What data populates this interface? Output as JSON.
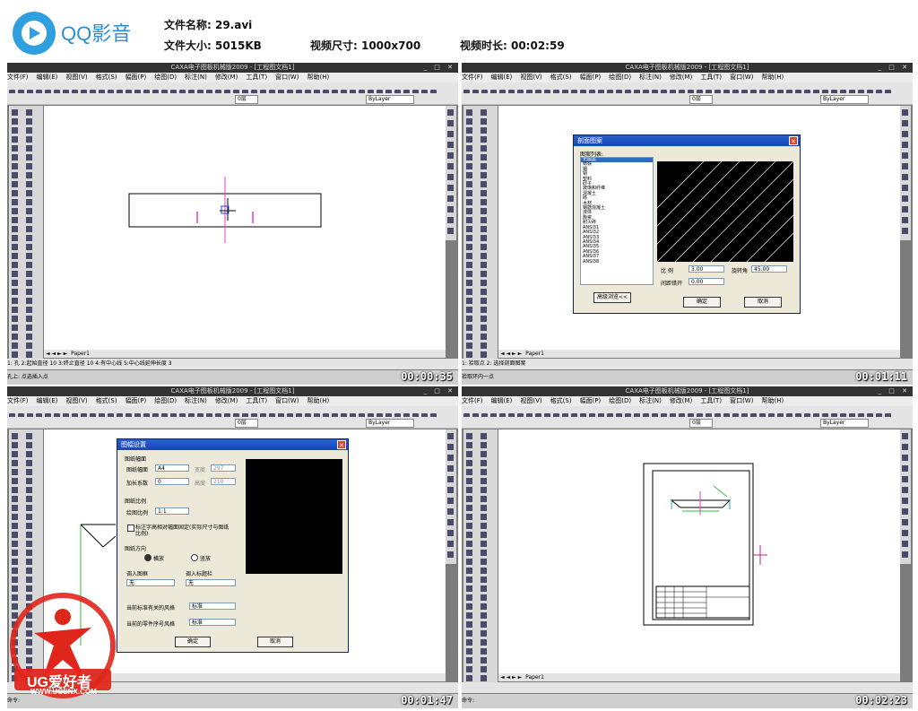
{
  "app": {
    "brand": "QQ影音"
  },
  "file_info": {
    "name_label": "文件名称: 29.avi",
    "size_label": "文件大小: 5015KB",
    "dimensions_label": "视频尺寸: 1000x700",
    "duration_label": "视频时长: 00:02:59"
  },
  "cad": {
    "window_title": "CAXA电子图板机械版2009 - [工程图文档1]",
    "menu": [
      "文件(F)",
      "编辑(E)",
      "视图(V)",
      "格式(S)",
      "幅面(P)",
      "绘图(D)",
      "标注(N)",
      "修改(M)",
      "工具(T)",
      "窗口(W)",
      "帮助(H)"
    ],
    "layer_combo": "0层",
    "linetype_combo": "ByLayer",
    "style_combo": "标准",
    "tab_model": "Paper1"
  },
  "frames": [
    {
      "timestamp": "00:00:35",
      "cmd": "1: 孔  2:起始直径 10  3:终止直径 10  4:有中心线  5:中心线延伸长度 3",
      "status": "孔上: 点选插入点"
    },
    {
      "timestamp": "00:01:11",
      "cmd": "1: 拾取点  2: 选择剖面图案",
      "status": "拾取环内一点"
    },
    {
      "timestamp": "00:01:47",
      "cmd": "",
      "status": "命令:"
    },
    {
      "timestamp": "00:02:23",
      "cmd": "",
      "status": "命令:"
    }
  ],
  "hatch_dialog": {
    "title": "剖面图案",
    "list_label": "图案列表:",
    "patterns": [
      "无图案",
      "铸铁",
      "钢",
      "铜",
      "塑料",
      "砂子",
      "玻璃和纤维",
      "混凝土",
      "砖",
      "木材",
      "钢筋混凝土",
      "液体",
      "陶瓷",
      "耐火砖",
      "ANSI31",
      "ANSI32",
      "ANSI33",
      "ANSI34",
      "ANSI35",
      "ANSI36",
      "ANSI37",
      "ANSI38"
    ],
    "scale_label": "比  例",
    "scale_value": "3.00",
    "rotate_label": "旋转角",
    "rotate_value": "45.00",
    "spacing_label": "间距错开",
    "spacing_value": "0.00",
    "advanced_button": "高级浏览<<",
    "ok_button": "确定",
    "cancel_button": "取消"
  },
  "sheet_dialog": {
    "title": "图幅设置",
    "group_size": "图纸幅面",
    "size_label": "图纸幅面",
    "size_value": "A4",
    "width_label": "宽度",
    "width_value": "297",
    "factor_label": "加长系数",
    "factor_value": "0",
    "height_label": "高度",
    "height_value": "210",
    "group_scale": "图纸比例",
    "scale_label": "绘图比例",
    "scale_value": "1:1",
    "checkbox_label": "标注字高相对幅面固定(实际尺寸与图纸比例)",
    "group_orient": "图纸方向",
    "orient_h": "横放",
    "orient_v": "竖放",
    "frame_label": "调入图框",
    "frame_value": "无",
    "title_label": "调入标题栏",
    "title_value": "无",
    "style1_label": "当前标准有关的风格",
    "style1_value": "标准",
    "style2_label": "当前的零件序号风格",
    "style2_value": "标准",
    "ok_button": "确定",
    "cancel_button": "取消"
  },
  "watermark": {
    "text": "UG爱好者",
    "url": "WWW.UGSNX.COM"
  },
  "colors": {
    "brand_blue": "#2a8fd6",
    "dialog_title": "#1447b8",
    "watermark_red": "#e0261b"
  }
}
